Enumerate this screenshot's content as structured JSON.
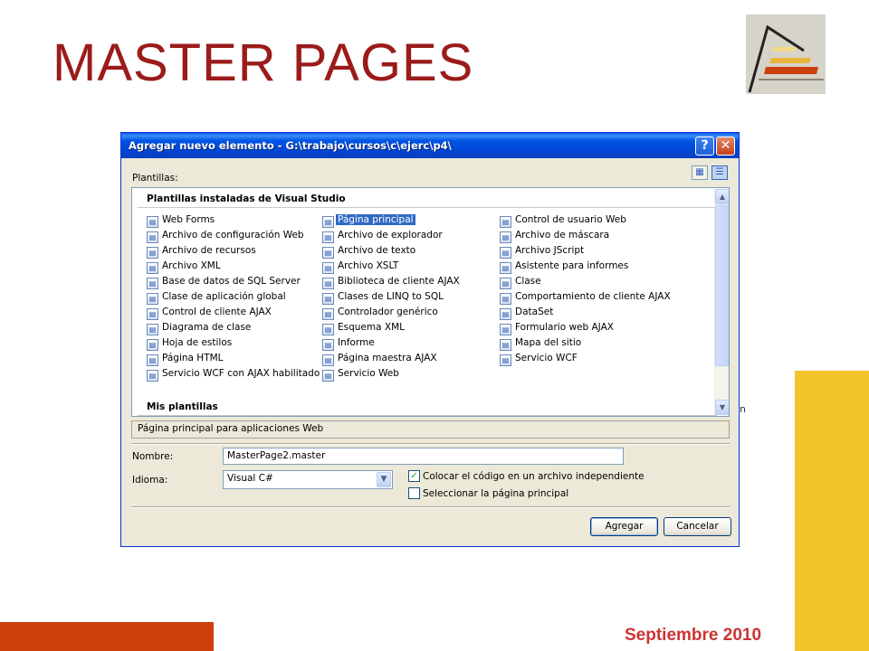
{
  "slide": {
    "title": "MASTER PAGES",
    "date": "Septiembre 2010"
  },
  "colors": {
    "title": "#9b1b1b",
    "accent_yellow": "#f4c42c",
    "accent_orange": "#cc3f0c",
    "date": "#cc3333",
    "xp_title_blue": "#0046d5",
    "selection": "#316ac5"
  },
  "background_fragments": [
    "n"
  ],
  "dialog": {
    "title": "Agregar nuevo elemento - G:\\trabajo\\cursos\\c\\ejerc\\p4\\",
    "help_label": "?",
    "close_label": "✕",
    "templates_label": "Plantillas:",
    "view_icons": [
      "large-icons-view-icon",
      "details-view-icon"
    ],
    "groups": [
      {
        "header": "Plantillas instaladas de Visual Studio",
        "columns": [
          [
            {
              "label": "Web Forms",
              "icon": "web-form-icon"
            },
            {
              "label": "Archivo de configuración Web",
              "icon": "config-file-icon"
            },
            {
              "label": "Archivo de recursos",
              "icon": "resource-file-icon"
            },
            {
              "label": "Archivo XML",
              "icon": "xml-file-icon"
            },
            {
              "label": "Base de datos de SQL Server",
              "icon": "database-icon"
            },
            {
              "label": "Clase de aplicación global",
              "icon": "global-class-icon"
            },
            {
              "label": "Control de cliente AJAX",
              "icon": "ajax-control-icon"
            },
            {
              "label": "Diagrama de clase",
              "icon": "class-diagram-icon"
            },
            {
              "label": "Hoja de estilos",
              "icon": "stylesheet-icon"
            },
            {
              "label": "Página HTML",
              "icon": "html-page-icon"
            },
            {
              "label": "Servicio WCF con AJAX habilitado",
              "icon": "wcf-ajax-icon"
            }
          ],
          [
            {
              "label": "Página principal",
              "icon": "master-page-icon",
              "selected": true
            },
            {
              "label": "Archivo de explorador",
              "icon": "browser-file-icon"
            },
            {
              "label": "Archivo de texto",
              "icon": "text-file-icon"
            },
            {
              "label": "Archivo XSLT",
              "icon": "xslt-file-icon"
            },
            {
              "label": "Biblioteca de cliente AJAX",
              "icon": "ajax-library-icon"
            },
            {
              "label": "Clases de LINQ to SQL",
              "icon": "linq-icon"
            },
            {
              "label": "Controlador genérico",
              "icon": "handler-icon"
            },
            {
              "label": "Esquema XML",
              "icon": "xml-schema-icon"
            },
            {
              "label": "Informe",
              "icon": "report-icon"
            },
            {
              "label": "Página maestra AJAX",
              "icon": "ajax-master-icon"
            },
            {
              "label": "Servicio Web",
              "icon": "web-service-icon"
            }
          ],
          [
            {
              "label": "Control de usuario Web",
              "icon": "user-control-icon"
            },
            {
              "label": "Archivo de máscara",
              "icon": "skin-file-icon"
            },
            {
              "label": "Archivo JScript",
              "icon": "jscript-icon"
            },
            {
              "label": "Asistente para informes",
              "icon": "report-wizard-icon"
            },
            {
              "label": "Clase",
              "icon": "class-icon"
            },
            {
              "label": "Comportamiento de cliente AJAX",
              "icon": "ajax-behavior-icon"
            },
            {
              "label": "DataSet",
              "icon": "dataset-icon"
            },
            {
              "label": "Formulario web AJAX",
              "icon": "ajax-webform-icon"
            },
            {
              "label": "Mapa del sitio",
              "icon": "sitemap-icon"
            },
            {
              "label": "Servicio WCF",
              "icon": "wcf-service-icon"
            }
          ]
        ]
      },
      {
        "header": "Mis plantillas"
      }
    ],
    "description": "Página principal para aplicaciones Web",
    "name_label": "Nombre:",
    "name_value": "MasterPage2.master",
    "language_label": "Idioma:",
    "language_value": "Visual C#",
    "option_separate_code": {
      "label": "Colocar el código en un archivo independiente",
      "checked": true
    },
    "option_select_master": {
      "label": "Seleccionar la página principal",
      "checked": false
    },
    "add_button": "Agregar",
    "cancel_button": "Cancelar"
  }
}
